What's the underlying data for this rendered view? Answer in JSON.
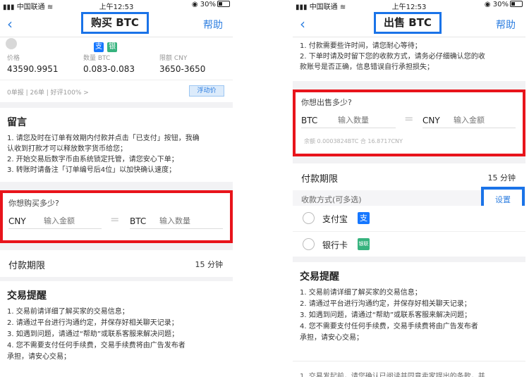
{
  "status_bar": {
    "carrier": "中国联通",
    "time": "上午12:53",
    "battery": "30%"
  },
  "left": {
    "nav": {
      "title": "购买 BTC",
      "help": "帮助"
    },
    "ad": {
      "price_label": "价格",
      "price_value": "43590.9951",
      "quantity_label": "数量 BTC",
      "quantity_value": "0.083-0.083",
      "limit_label": "限额 CNY",
      "limit_value": "3650-3650",
      "meta": "0单报 | 26单 | 好评100% >",
      "float_price": "浮动价"
    },
    "message": {
      "title": "留言",
      "lines": [
        "1. 请您及时在订单有效期内付款并点击「已支付」按钮，我确",
        "认收到打款才可以释放数字货币给您；",
        "2. 开始交易后数字币由系统锁定托管，请您安心下单；",
        "3. 转账时请备注「订单编号后4位」以加快确认速度；"
      ]
    },
    "buy_amount": {
      "question": "你想购买多少?",
      "currency_left": "CNY",
      "placeholder_left": "输入金额",
      "equals": "=",
      "currency_right": "BTC",
      "placeholder_right": "输入数量"
    },
    "payment_period": {
      "label": "付款期限",
      "value": "15 分钟"
    },
    "tips": {
      "title": "交易提醒",
      "lines": [
        "1. 交易前请详细了解买家的交易信息；",
        "2. 请通过平台进行沟通约定，并保存好相关聊天记录；",
        "3. 如遇到问题，请通过“帮助”或联系客服来解决问题；",
        "4. 您不需要支付任何手续费，交易手续费将由广告发布者",
        "承担，请安心交易；"
      ]
    }
  },
  "right": {
    "nav": {
      "title": "出售 BTC",
      "help": "帮助"
    },
    "notice_lines": [
      "1. 付款需要些许时间，请您耐心等待；",
      "2. 下单时请及时留下您的收款方式，请务必仔细确认您的收",
      "款账号是否正确，信息错误自行承担损失；"
    ],
    "sell_amount": {
      "question": "你想出售多少?",
      "currency_left": "BTC",
      "placeholder_left": "输入数量",
      "equals": "=",
      "currency_right": "CNY",
      "placeholder_right": "输入金额",
      "balance": "余额 0.0003824BTC 合 16.8717CNY"
    },
    "payment_period": {
      "label": "付款期限",
      "value": "15 分钟"
    },
    "payment_methods": {
      "header": "收款方式(可多选)",
      "settings": "设置",
      "options": [
        {
          "label": "支付宝",
          "logo": "支"
        },
        {
          "label": "银行卡",
          "logo": "银联"
        }
      ]
    },
    "tips": {
      "title": "交易提醒",
      "lines": [
        "1. 交易前请详细了解买家的交易信息；",
        "2. 请通过平台进行沟通约定，并保存好相关聊天记录；",
        "3. 如遇到问题，请通过“帮助”或联系客服来解决问题；",
        "4. 您不需要支付任何手续费，交易手续费将由广告发布者",
        "承担，请安心交易；"
      ]
    },
    "bottom_note": "1. 交易发起前，请您确认已阅读并同意卖家提出的条款，并"
  },
  "colors": {
    "accent": "#1a73e8",
    "highlight_red": "#e8141b",
    "link": "#2f7fe0"
  }
}
